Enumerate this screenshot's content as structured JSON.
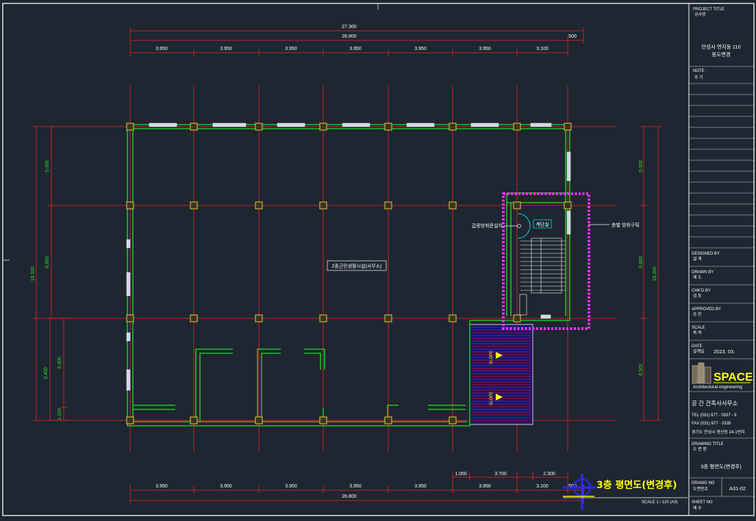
{
  "dimensions": {
    "overall_top": "27.300",
    "overall_top_sub": "26.800",
    "top_extra": "500",
    "top_bays": [
      "3.950",
      "3.950",
      "3.950",
      "3.950",
      "3.950",
      "3.950",
      "3.100"
    ],
    "bottom_bays": [
      "3.950",
      "3.950",
      "3.950",
      "3.950",
      "3.950",
      "3.950",
      "3.100"
    ],
    "bottom_extra": "500",
    "bottom_total": "26.800",
    "bottom_sub": [
      "1.050",
      "3.700",
      "2.300"
    ],
    "left_total": "18.300",
    "left_parts": [
      "5.000",
      "6.800"
    ],
    "left_low": [
      "6.400",
      "5.300",
      "1.100"
    ],
    "right_total": "18.300",
    "right_parts": [
      "5.000",
      "6.800",
      "6.500"
    ]
  },
  "labels": {
    "room": "2종근린생활시설(사무소)",
    "stair": "계단실",
    "left_note": "갑종방화문설치",
    "right_note": "층별 방화구획",
    "slope_1": "SLOPE",
    "slope_2": "SLOPE"
  },
  "title_block": {
    "project_title_label": "PROJECT TITLE",
    "project_title_kr": "공사명",
    "project_name_1": "안성시 연지동 110",
    "project_name_2": "용도변경",
    "note_label": "NOTE :",
    "note_kr": "주 기",
    "designed_label": "DESIGNED BY",
    "designed_kr": "설 계",
    "drawn_label": "DRAWN BY",
    "drawn_kr": "제 도",
    "checked_label": "CHK'D BY",
    "checked_kr": "검 토",
    "approved_label": "APPROVED BY",
    "approved_kr": "승 인",
    "scale_label": "SCALE",
    "scale_kr": "축 적",
    "date_label": "DATE",
    "date_kr": "설계일",
    "date_value": "2023. 03.",
    "logo_text": "SPACE",
    "logo_sub": "Architectural engineering",
    "firm_name": "공 간  건축사사무소",
    "tel": "TEL (031) 677 - 0337 - 9",
    "fax": "FAX (031) 677 - 0335",
    "address": "경기도 안성시 봉산동 24-1번지",
    "drawing_title_label": "DRAWING TITLE",
    "drawing_title_kr": "도 면 명",
    "drawing_title_value": "3층 평면도(변경후)",
    "dwg_no_label": "DRAWG NO",
    "dwg_no_kr": "도면번호",
    "dwg_no_value": "A31-02",
    "sheet_no_label": "SHEET NO",
    "sheet_no_kr": "매 수"
  },
  "bottom_title": {
    "title": "3층 평면도(변경후)",
    "scale": "SCALE  1 / 120 (A3)"
  },
  "colors": {
    "background": "#1e2631",
    "grid_line": "#ff2020",
    "wall": "#23e423",
    "column": "#e8d040",
    "stair_highlight": "#ff33ff",
    "ramp_fill": "#14146e",
    "ramp_lines": "#c8142c"
  }
}
